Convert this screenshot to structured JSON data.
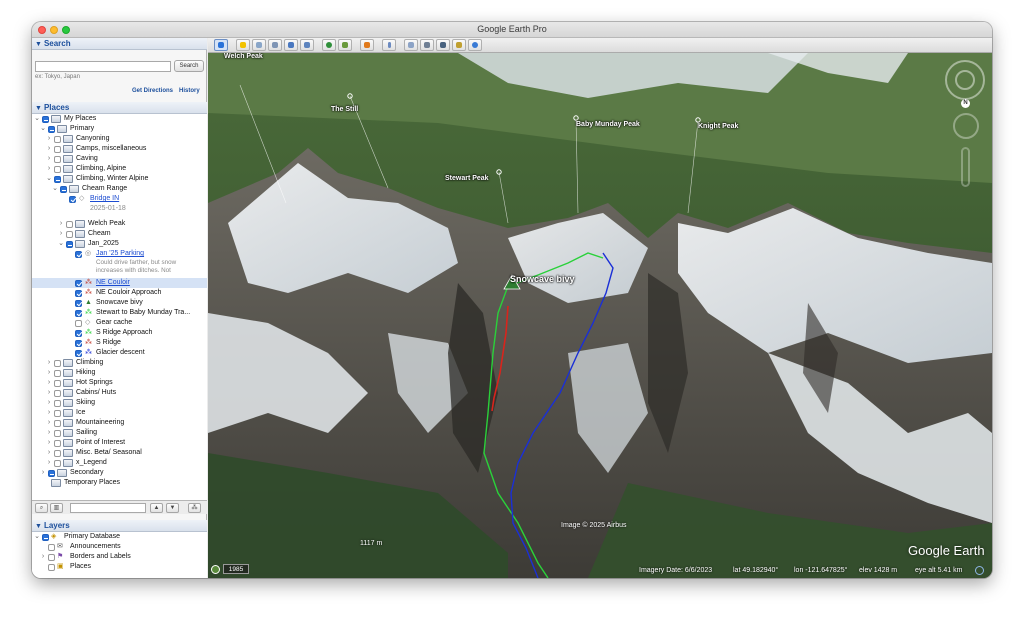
{
  "window": {
    "title": "Google Earth Pro"
  },
  "search": {
    "header": "Search",
    "button": "Search",
    "hint": "ex: Tokyo, Japan",
    "get_directions": "Get Directions",
    "history": "History"
  },
  "places": {
    "header": "Places",
    "my_places": "My Places",
    "primary": "Primary",
    "canyoning": "Canyoning",
    "camps": "Camps, miscellaneous",
    "caving": "Caving",
    "climbing_alpine": "Climbing, Alpine",
    "climbing_winter": "Climbing, Winter Alpine",
    "cheam_range": "Cheam Range",
    "bridge_in": "Bridge IN",
    "bridge_date": "2025-01-18",
    "welch_peak": "Welch Peak",
    "cheam": "Cheam",
    "jan_2025": "Jan_2025",
    "jan25_parking": "Jan '25 Parking",
    "parking_note": "Could drive farther, but snow increases with ditches. Not",
    "ne_couloir": "NE Couloir",
    "ne_couloir_approach": "NE Couloir Approach",
    "snowcave_bivy": "Snowcave bivy",
    "stewart_to_baby": "Stewart to Baby Munday Tra...",
    "gear_cache": "Gear cache",
    "s_ridge_approach": "S Ridge Approach",
    "s_ridge": "S Ridge",
    "glacier_descent": "Glacier descent",
    "climbing": "Climbing",
    "hiking": "Hiking",
    "hot_springs": "Hot Springs",
    "cabins_huts": "Cabins/ Huts",
    "skiing": "Skiing",
    "ice": "Ice",
    "mountaineering": "Mountaineering",
    "sailing": "Sailing",
    "point_of_interest": "Point of Interest",
    "misc_beta": "Misc. Beta/ Seasonal",
    "x_legend": "x_Legend",
    "secondary": "Secondary",
    "temporary": "Temporary Places"
  },
  "layers": {
    "header": "Layers",
    "primary_database": "Primary Database",
    "announcements": "Announcements",
    "borders": "Borders and Labels",
    "places": "Places"
  },
  "map": {
    "labels": {
      "welch": "Welch Peak",
      "the_still": "The Still",
      "baby_munday": "Baby Munday Peak",
      "knight": "Knight Peak",
      "stewart": "Stewart Peak",
      "snowcave": "Snowcave bivy"
    },
    "historical_year": "1985",
    "image_credit": "Image © 2025 Airbus",
    "scale": "1117 m",
    "logo": "Google Earth",
    "status": {
      "imagery_date": "Imagery Date: 6/6/2023",
      "lat": "lat   49.182940°",
      "lon": "lon -121.647825°",
      "elev": "elev  1428 m",
      "eye_alt": "eye alt   5.41 km"
    },
    "compass_north": "N"
  },
  "colors": {
    "route_red": "#d9241c",
    "route_blue": "#1a2fd6",
    "route_green": "#2ad13a",
    "link_blue": "#1c4cd1",
    "panel_header_blue": "#1c4f9c"
  }
}
